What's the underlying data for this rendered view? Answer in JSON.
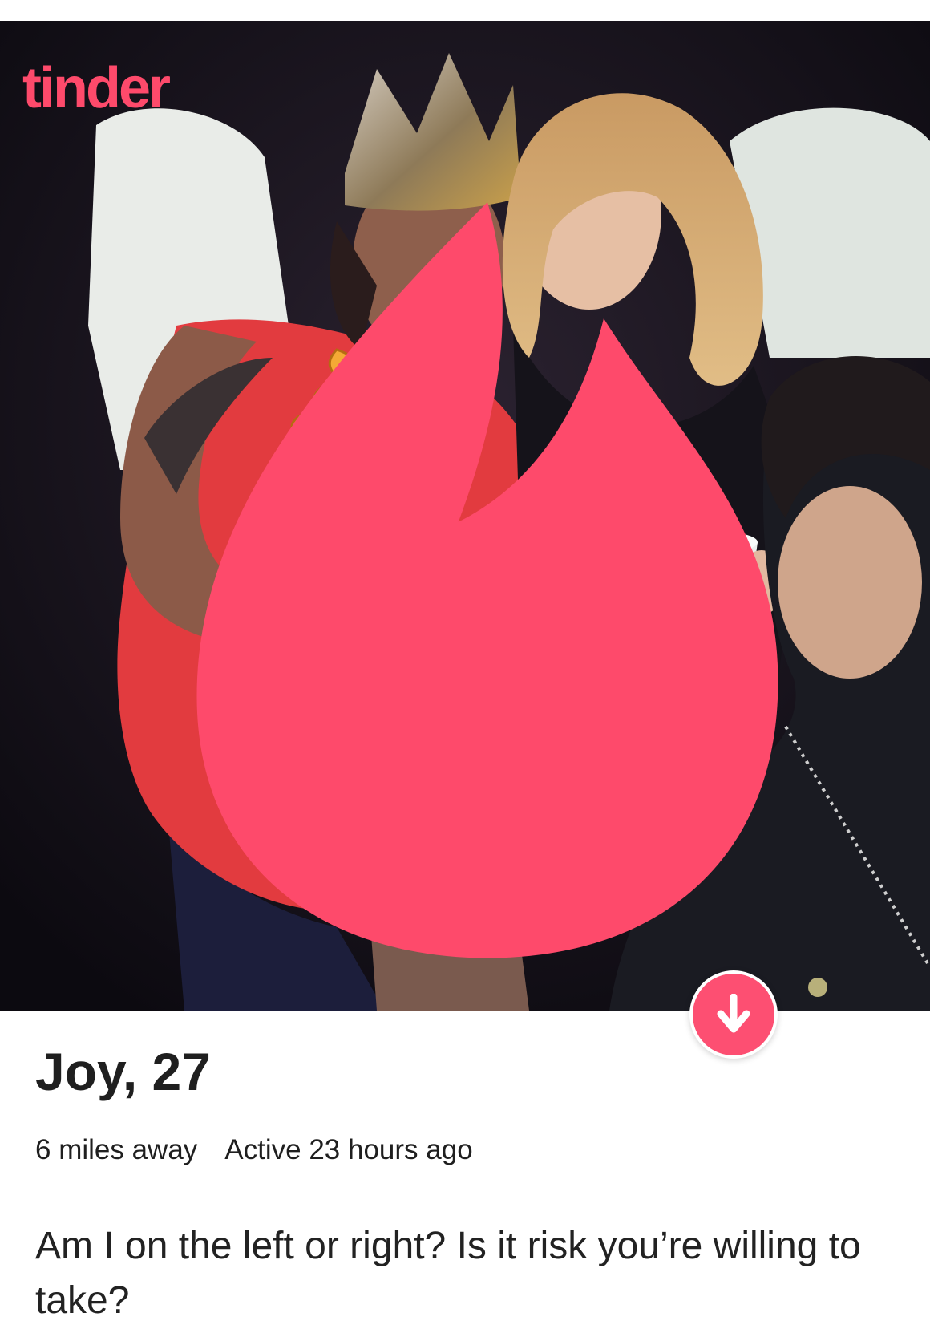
{
  "app": {
    "logo_text": "tinder",
    "brand_color": "#fd4f72"
  },
  "photo": {
    "overlay_icon": "poop-emoji-icon"
  },
  "profile": {
    "name_age": "Joy, 27",
    "distance": "6 miles away",
    "activity": "Active 23 hours ago",
    "bio": "Am I on the left or right? Is it risk you’re willing to take?"
  },
  "actions": {
    "info_icon": "arrow-down-icon"
  }
}
